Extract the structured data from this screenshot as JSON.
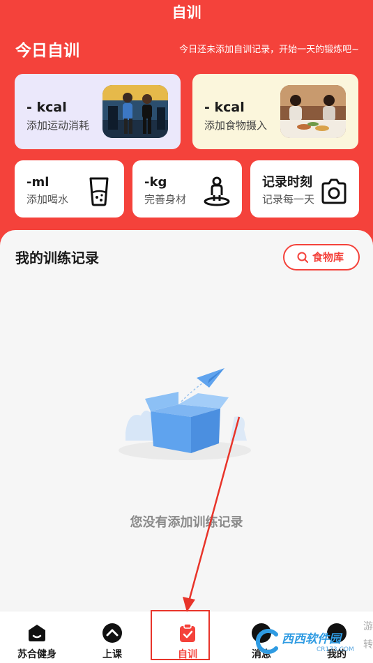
{
  "header": {
    "title": "自训",
    "section_title": "今日自训",
    "hint": "今日还未添加自训记录，开始一天的锻炼吧~"
  },
  "cards": {
    "exercise": {
      "value": "- kcal",
      "label": "添加运动消耗"
    },
    "food": {
      "value": "- kcal",
      "label": "添加食物摄入"
    },
    "water": {
      "value": "-ml",
      "label": "添加喝水"
    },
    "weight": {
      "value": "-kg",
      "label": "完善身材"
    },
    "moment": {
      "value": "记录时刻",
      "label": "记录每一天"
    }
  },
  "records": {
    "title": "我的训练记录",
    "food_library": "食物库",
    "empty_text": "您没有添加训练记录"
  },
  "tabbar": {
    "items": [
      {
        "label": "苏合健身",
        "icon": "home-icon"
      },
      {
        "label": "上课",
        "icon": "chevron-up-icon"
      },
      {
        "label": "自训",
        "icon": "clipboard-check-icon",
        "active": true
      },
      {
        "label": "消息",
        "icon": "message-icon"
      },
      {
        "label": "我的",
        "icon": "profile-icon"
      }
    ]
  },
  "watermark": {
    "text": "西西软件园",
    "url": "CR173.COM",
    "side": "游转"
  },
  "colors": {
    "brand_red": "#f4423b",
    "exercise_card": "#ebe8fb",
    "food_card": "#fbf6dc"
  }
}
